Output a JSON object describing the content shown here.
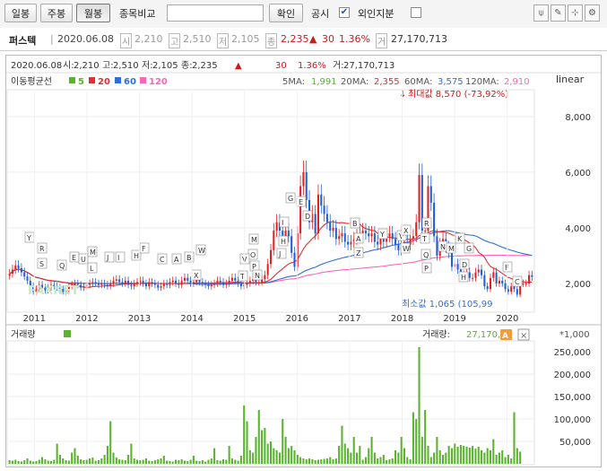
{
  "toolbar": {
    "period_buttons": [
      "일봉",
      "주봉",
      "월봉"
    ],
    "active_period": "월봉",
    "compare_label": "종목비교",
    "compare_input_value": "",
    "confirm_label": "확인",
    "disclosure_label": "공시",
    "disclosure_checked": true,
    "foreign_label": "외인지분",
    "foreign_checked": false
  },
  "stock": {
    "name": "퍼스텍",
    "date": "2020.06.08",
    "open": "2,210",
    "high": "2,510",
    "low": "2,105",
    "close": "2,235",
    "change_arrow": "▲",
    "change": "30",
    "change_pct": "1.36%",
    "volume": "27,170,713"
  },
  "ohlc_line": {
    "date": "2020.06.08",
    "open_label": "시:",
    "open": "2,210",
    "high_label": "고:",
    "high": "2,510",
    "low_label": "저:",
    "low": "2,105",
    "close_label": "종:",
    "close": "2,235",
    "arrow": "▲",
    "change": "30",
    "change_pct": "1.36%",
    "volume_label": "거:",
    "volume": "27,170,713"
  },
  "legend": {
    "title": "이동평균선",
    "items": [
      {
        "label": "5",
        "color": "#58b32d"
      },
      {
        "label": "20",
        "color": "#e03030"
      },
      {
        "label": "60",
        "color": "#2f6fdc"
      },
      {
        "label": "120",
        "color": "#ff66b3"
      }
    ],
    "ma5_label": "5MA:",
    "ma5": "1,991",
    "ma20_label": "20MA:",
    "ma20": "2,355",
    "ma60_label": "60MA:",
    "ma60": "3,575",
    "ma120_label": "120MA:",
    "ma120": "2,910",
    "scale": "linear"
  },
  "annotations": {
    "max": "최대값 8,570 (-73,92%)",
    "min": "최소값 1,065 (105,99"
  },
  "volume_panel": {
    "title": "거래량",
    "value_label": "거래량:",
    "value": "27,170,",
    "unit": "*1,000"
  },
  "chart_data": {
    "type": "candlestick",
    "price_axis": {
      "ticks": [
        "2,000",
        "4,000",
        "6,000",
        "8,000"
      ],
      "tick_values": [
        2000,
        4000,
        6000,
        8000
      ],
      "ylim": [
        1000,
        8900
      ],
      "scale": "linear"
    },
    "volume_axis": {
      "ticks": [
        "50,000",
        "100,000",
        "150,000",
        "200,000",
        "250,000"
      ],
      "tick_values": [
        50000,
        100000,
        150000,
        200000,
        250000
      ],
      "ylim": [
        0,
        270000
      ]
    },
    "x_labels": [
      "2011",
      "2012",
      "2013",
      "2014",
      "2015",
      "2016",
      "2017",
      "2018",
      "2019",
      "2020"
    ],
    "start_year": 2010.5,
    "end_year": 2020.5,
    "close": [
      2350,
      2500,
      2650,
      2550,
      2400,
      2250,
      2100,
      1900,
      1700,
      1800,
      1950,
      1850,
      1750,
      1850,
      1950,
      1900,
      1850,
      1800,
      1700,
      1750,
      1900,
      1950,
      2000,
      1950,
      1850,
      1900,
      1950,
      2000,
      2050,
      2000,
      1950,
      2000,
      1950,
      1900,
      2000,
      2100,
      2150,
      2050,
      2000,
      2100,
      1950,
      1900,
      2000,
      2050,
      2100,
      2000,
      1900,
      2050,
      2000,
      1950,
      1850,
      1900,
      2000,
      1950,
      2050,
      2100,
      2000,
      1950,
      2100,
      2200,
      2100,
      2000,
      2050,
      2150,
      2050,
      2000,
      1950,
      1900,
      1950,
      2000,
      2100,
      2050,
      1950,
      2000,
      2100,
      2200,
      2100,
      2000,
      1900,
      1950,
      2000,
      2100,
      2150,
      2050,
      2050,
      2150,
      2300,
      2700,
      3200,
      3900,
      4200,
      3900,
      3600,
      3900,
      3700,
      3100,
      2600,
      3800,
      5500,
      6000,
      5000,
      4200,
      4500,
      3800,
      5200,
      4800,
      4500,
      4200,
      3900,
      4000,
      3600,
      3700,
      3800,
      3500,
      3400,
      3500,
      3600,
      3700,
      3800,
      3900,
      3800,
      3700,
      3800,
      3500,
      3400,
      3600,
      3500,
      3700,
      3800,
      3600,
      3400,
      3200,
      3300,
      3500,
      3400,
      3600,
      3700,
      4200,
      5900,
      3900,
      3900,
      5500,
      4900,
      3700,
      3000,
      3400,
      3600,
      3300,
      3100,
      2600,
      2700,
      2500,
      2300,
      2300,
      2400,
      2200,
      2200,
      2400,
      2500,
      2300,
      1900,
      1800,
      2200,
      2400,
      2000,
      2100,
      2000,
      1800,
      1700,
      1900,
      1800,
      1600,
      2000,
      2000,
      2000,
      2300,
      2235
    ],
    "volume": [
      8000,
      7000,
      9000,
      6000,
      5000,
      8000,
      12000,
      7000,
      5000,
      6000,
      9000,
      15000,
      10000,
      7000,
      6000,
      9000,
      45000,
      20000,
      12000,
      8000,
      7000,
      25000,
      35000,
      18000,
      10000,
      8000,
      9000,
      12000,
      14000,
      7000,
      8000,
      12000,
      20000,
      40000,
      95000,
      25000,
      14000,
      10000,
      9000,
      8000,
      20000,
      45000,
      12000,
      9000,
      8000,
      9000,
      12000,
      7000,
      6000,
      8000,
      10000,
      12000,
      18000,
      7000,
      6000,
      5000,
      9000,
      8000,
      10000,
      7000,
      6000,
      9000,
      18000,
      7000,
      6000,
      8000,
      5000,
      9000,
      12000,
      35000,
      8000,
      7000,
      10000,
      9000,
      40000,
      12000,
      9000,
      7000,
      18000,
      130000,
      95000,
      30000,
      25000,
      60000,
      120000,
      75000,
      80000,
      45000,
      50000,
      35000,
      30000,
      25000,
      100000,
      60000,
      35000,
      40000,
      30000,
      20000,
      15000,
      12000,
      10000,
      12000,
      10000,
      8000,
      9000,
      10000,
      11000,
      12000,
      15000,
      10000,
      12000,
      40000,
      85000,
      45000,
      35000,
      25000,
      60000,
      25000,
      40000,
      9000,
      15000,
      35000,
      60000,
      25000,
      12000,
      15000,
      20000,
      8000,
      10000,
      12000,
      30000,
      25000,
      60000,
      35000,
      15000,
      10000,
      115000,
      100000,
      260000,
      60000,
      120000,
      40000,
      15000,
      25000,
      60000,
      30000,
      20000,
      25000,
      40000,
      35000,
      45000,
      38000,
      42000,
      40000,
      38000,
      36000,
      40000,
      34000,
      38000,
      30000,
      25000,
      35000,
      30000,
      55000,
      20000,
      25000,
      30000,
      15000,
      20000,
      12000,
      115000,
      35000,
      27170
    ]
  }
}
